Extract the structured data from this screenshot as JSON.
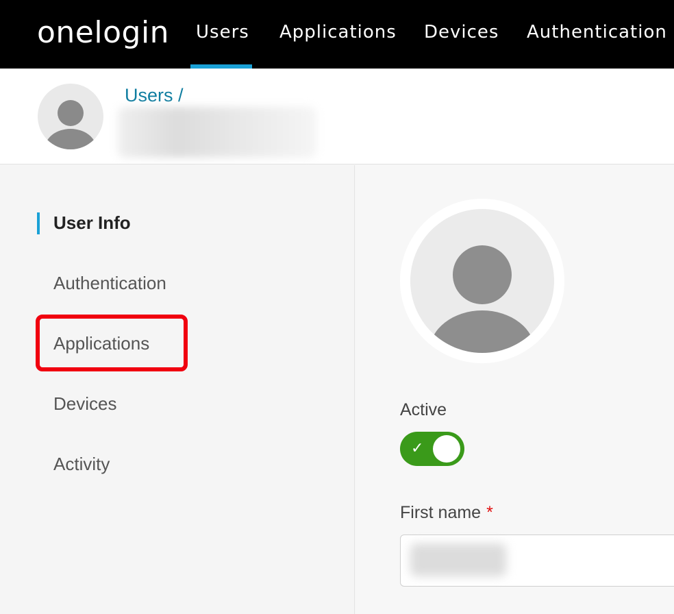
{
  "nav": {
    "logo": "onelogin",
    "items": [
      {
        "label": "Users",
        "active": true
      },
      {
        "label": "Applications",
        "active": false
      },
      {
        "label": "Devices",
        "active": false
      },
      {
        "label": "Authentication",
        "active": false
      }
    ]
  },
  "header": {
    "breadcrumb": "Users /"
  },
  "sidebar": {
    "items": [
      {
        "label": "User Info",
        "active": true
      },
      {
        "label": "Authentication",
        "active": false
      },
      {
        "label": "Applications",
        "active": false,
        "highlighted": true
      },
      {
        "label": "Devices",
        "active": false
      },
      {
        "label": "Activity",
        "active": false
      }
    ]
  },
  "form": {
    "active_label": "Active",
    "active_value": true,
    "first_name_label": "First name",
    "required_marker": "*"
  },
  "colors": {
    "accent": "#1aa1d6",
    "breadcrumb": "#0f7da0",
    "toggle_on": "#3a9a1a",
    "highlight": "#f0000f"
  },
  "icons": {
    "avatar": "user-silhouette-icon",
    "toggle_check": "check-icon"
  }
}
